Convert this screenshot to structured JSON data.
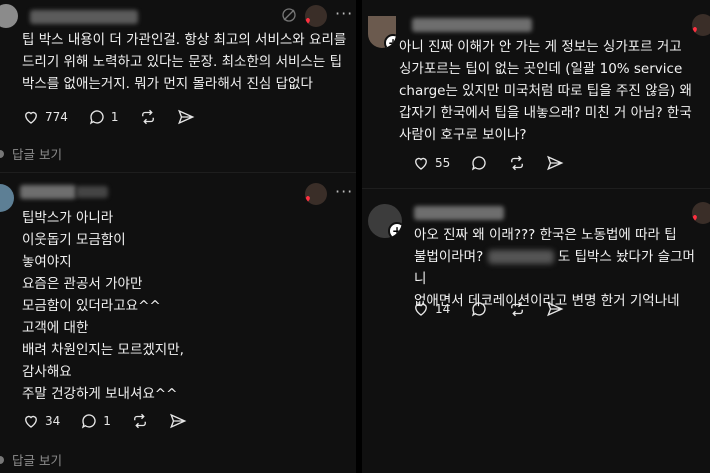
{
  "left": {
    "post1": {
      "text": "팁 박스 내용이 더 가관인걸. 항상 최고의 서비스와 요리를\n드리기 위해 노력하고 있다는 문장.  최소한의 서비스는 팁\n박스를 없애는거지. 뭐가 먼지 몰라해서 진심 답없다",
      "likes": "774",
      "comments": "1",
      "reply_label": "답글 보기"
    },
    "post2": {
      "text": "팁박스가 아니라\n이웃돕기 모금함이\n놓여야지\n요즘은 관공서 가야만\n모금함이 있더라고요^^\n고객에 대한\n배려 차원인지는 모르겠지만,\n감사해요\n주말 건강하게 보내셔요^^",
      "likes": "34",
      "comments": "1",
      "reply_label": "답글 보기"
    }
  },
  "right": {
    "post1": {
      "text": "아니 진짜 이해가 안 가는 게 정보는 싱가포르 거고\n싱가포르는 팁이 없는 곳인데 (일괄 10% service\ncharge는 있지만 미국처럼 따로 팁을 주진 않음) 왜\n갑자기 한국에서 팁을 내놓으래? 미친 거 아님? 한국\n사람이 호구로 보이나?",
      "likes": "55"
    },
    "post2": {
      "line1": "아오 진짜 왜 이래??? 한국은 노동법에 따라 팁",
      "line2_a": "불법이라며?",
      "line2_b": "도 팁박스 놨다가 슬그머니",
      "line3": "없애면서 데코레이션이라고 변명 한거 기억나네",
      "likes": "14"
    }
  },
  "icons": {
    "like": "heart-outline-icon",
    "comment": "speech-bubble-icon",
    "repost": "repost-arrows-icon",
    "share": "paper-plane-icon",
    "more": "ellipsis-icon",
    "follow": "plus-icon"
  },
  "colors": {
    "heart": "#ff3040",
    "muted": "#8d8d8d",
    "background": "#101010"
  }
}
